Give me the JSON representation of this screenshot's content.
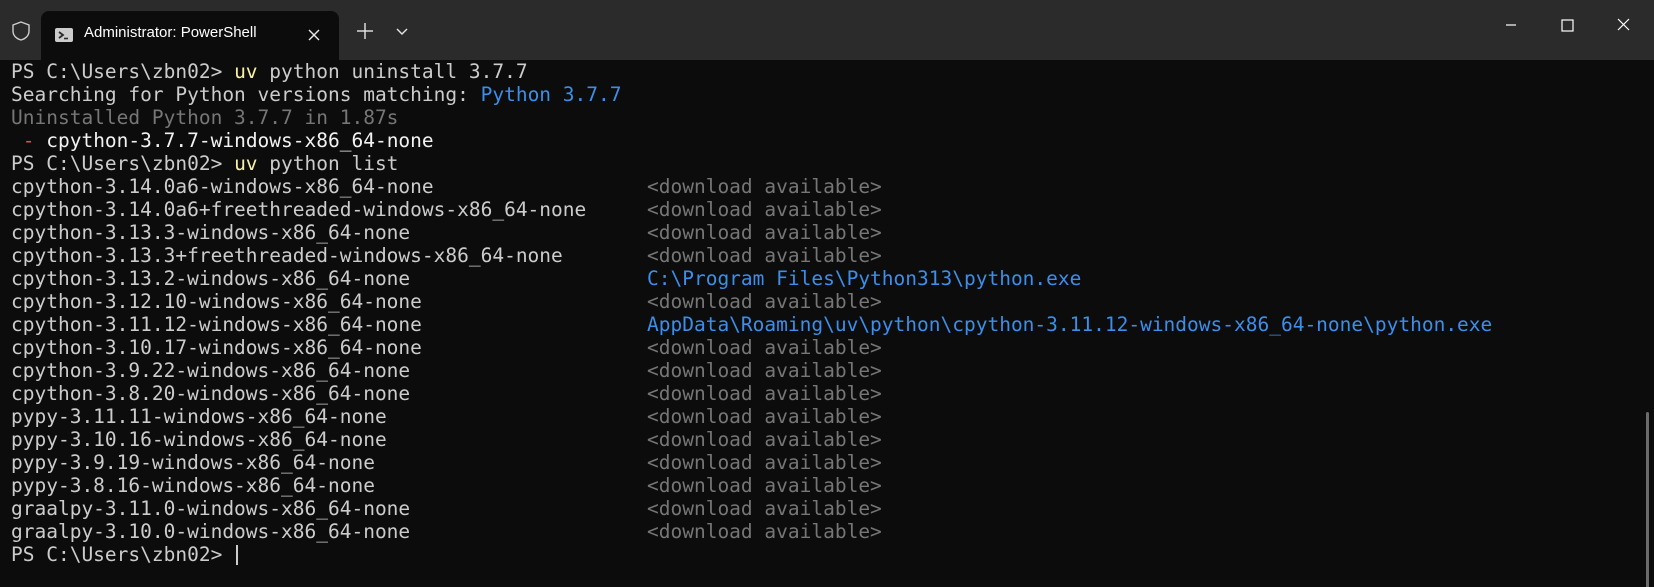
{
  "window": {
    "tab_title": "Administrator: PowerShell"
  },
  "icons": [
    "shield-icon",
    "powershell-icon",
    "close-icon",
    "plus-icon",
    "chevron-down-icon",
    "minimize-icon",
    "maximize-icon",
    "window-close-icon"
  ],
  "colors": {
    "background": "#0c0c0c",
    "titlebar": "#2b2b2b",
    "command": "#f9f1a5",
    "highlight": "#3b8eea",
    "dim": "#767676",
    "bullet": "#e74856"
  },
  "terminal": {
    "l1": {
      "prompt": "PS C:\\Users\\zbn02> ",
      "cmd": "uv",
      "args": " python uninstall 3.7.7"
    },
    "l2": {
      "text": "Searching for Python versions matching: ",
      "highlight": "Python 3.7.7"
    },
    "l3": {
      "text": "Uninstalled Python 3.7.7 in 1.87s"
    },
    "l4": {
      "bullet": " - ",
      "text": "cpython-3.7.7-windows-x86_64-none"
    },
    "l5": {
      "prompt": "PS C:\\Users\\zbn02> ",
      "cmd": "uv",
      "args": " python list"
    },
    "list": [
      {
        "name": "cpython-3.14.0a6-windows-x86_64-none",
        "status": "<download available>"
      },
      {
        "name": "cpython-3.14.0a6+freethreaded-windows-x86_64-none",
        "status": "<download available>"
      },
      {
        "name": "cpython-3.13.3-windows-x86_64-none",
        "status": "<download available>"
      },
      {
        "name": "cpython-3.13.3+freethreaded-windows-x86_64-none",
        "status": "<download available>"
      },
      {
        "name": "cpython-3.13.2-windows-x86_64-none",
        "status": "C:\\Program Files\\Python313\\python.exe"
      },
      {
        "name": "cpython-3.12.10-windows-x86_64-none",
        "status": "<download available>"
      },
      {
        "name": "cpython-3.11.12-windows-x86_64-none",
        "status": "AppData\\Roaming\\uv\\python\\cpython-3.11.12-windows-x86_64-none\\python.exe"
      },
      {
        "name": "cpython-3.10.17-windows-x86_64-none",
        "status": "<download available>"
      },
      {
        "name": "cpython-3.9.22-windows-x86_64-none",
        "status": "<download available>"
      },
      {
        "name": "cpython-3.8.20-windows-x86_64-none",
        "status": "<download available>"
      },
      {
        "name": "pypy-3.11.11-windows-x86_64-none",
        "status": "<download available>"
      },
      {
        "name": "pypy-3.10.16-windows-x86_64-none",
        "status": "<download available>"
      },
      {
        "name": "pypy-3.9.19-windows-x86_64-none",
        "status": "<download available>"
      },
      {
        "name": "pypy-3.8.16-windows-x86_64-none",
        "status": "<download available>"
      },
      {
        "name": "graalpy-3.11.0-windows-x86_64-none",
        "status": "<download available>"
      },
      {
        "name": "graalpy-3.10.0-windows-x86_64-none",
        "status": "<download available>"
      }
    ],
    "final_prompt": "PS C:\\Users\\zbn02> "
  }
}
